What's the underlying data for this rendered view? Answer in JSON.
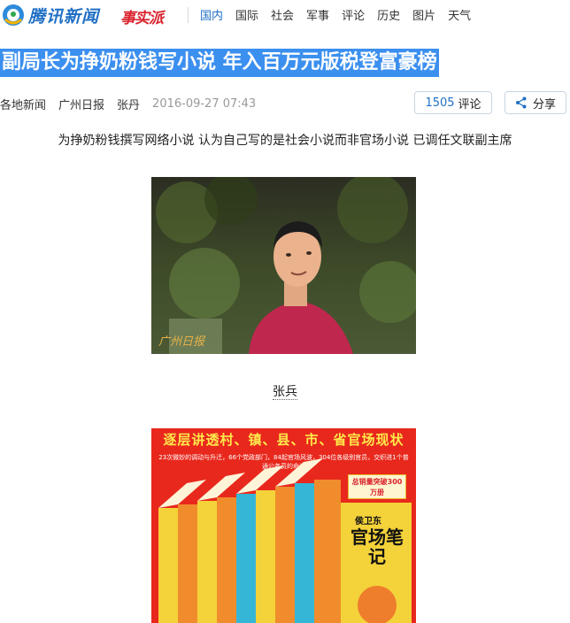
{
  "header": {
    "logo_text": "腾讯新闻",
    "brand2": "事实派",
    "nav": [
      "国内",
      "国际",
      "社会",
      "军事",
      "评论",
      "历史",
      "图片",
      "天气"
    ],
    "active_nav_index": 0
  },
  "article": {
    "title": "副局长为挣奶粉钱写小说 年入百万元版税登富豪榜",
    "source": "各地新闻",
    "paper": "广州日报",
    "author": "张丹",
    "time": "2016-09-27 07:43",
    "comment_count": "1505",
    "comment_label": "评论",
    "share_label": "分享",
    "lead": "为挣奶粉钱撰写网络小说 认为自己写的是社会小说而非官场小说 已调任文联副主席",
    "photo_caption": "张兵",
    "photo_watermark": "广州日报"
  },
  "cover": {
    "banner": "逐层讲透村、镇、县、市、省官场现状",
    "sub": "23次微妙的调动与升迁，66个党政部门，84起官场风波，304位各级别官员，交织进1个普通公务员的命运",
    "badge": "总销量突破300万册",
    "author": "侯卫东",
    "book_title": "官场笔记"
  },
  "colors": {
    "accent": "#1f6fc5",
    "title_highlight": "#3b8fef",
    "brand_red": "#d9232e",
    "cover_red": "#e8281d"
  }
}
